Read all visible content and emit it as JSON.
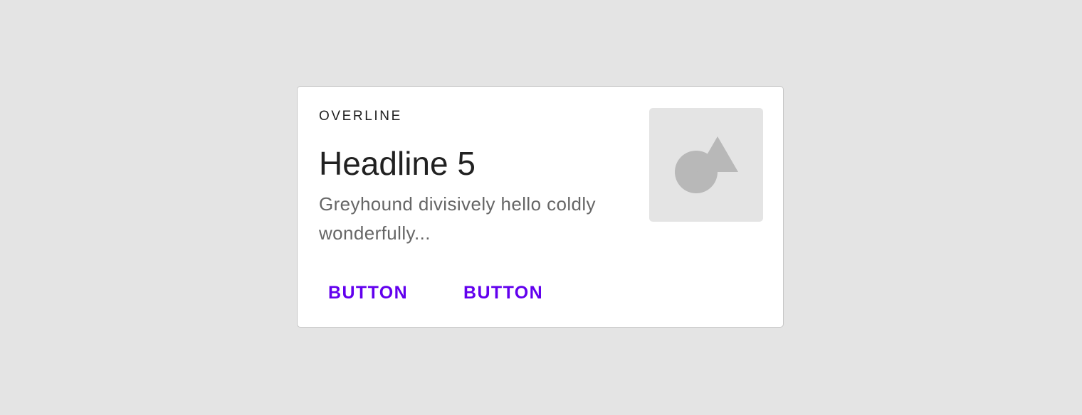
{
  "card": {
    "overline": "OVERLINE",
    "headline": "Headline 5",
    "body": "Greyhound divisively hello coldly wonderfully...",
    "actions": [
      {
        "label": "BUTTON"
      },
      {
        "label": "BUTTON"
      }
    ],
    "media": {
      "icon": "image-placeholder-icon"
    }
  },
  "colors": {
    "background": "#e4e4e4",
    "card": "#ffffff",
    "card_border": "#c6c6c6",
    "accent": "#6200ee",
    "placeholder": "#e4e4e4",
    "placeholder_shape": "#b8b8b8"
  }
}
